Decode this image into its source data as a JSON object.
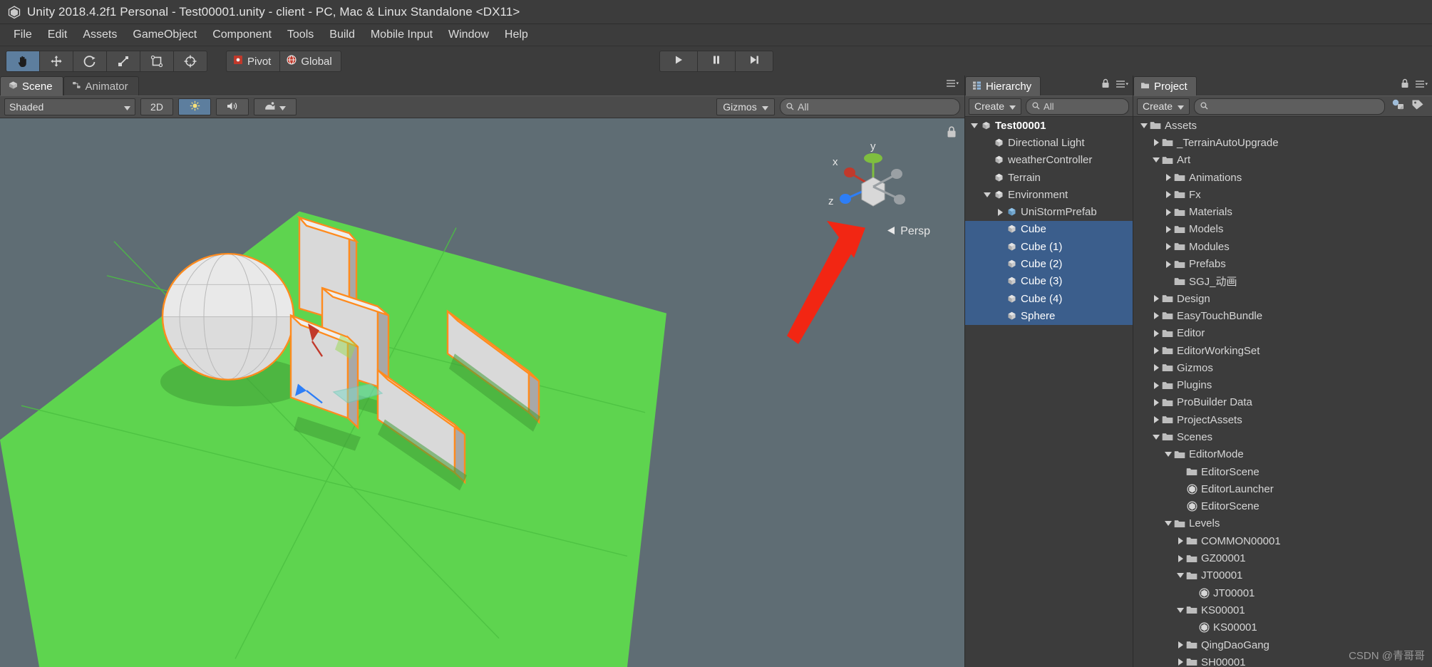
{
  "window": {
    "title": "Unity 2018.4.2f1 Personal - Test00001.unity - client - PC, Mac & Linux Standalone <DX11>",
    "logo_icon": "unity-logo-icon"
  },
  "menubar": {
    "items": [
      {
        "label": "File"
      },
      {
        "label": "Edit"
      },
      {
        "label": "Assets"
      },
      {
        "label": "GameObject"
      },
      {
        "label": "Component"
      },
      {
        "label": "Tools"
      },
      {
        "label": "Build"
      },
      {
        "label": "Mobile Input"
      },
      {
        "label": "Window"
      },
      {
        "label": "Help"
      }
    ]
  },
  "toolbar": {
    "tools": [
      {
        "name": "hand-tool",
        "icon": "hand-icon",
        "active": true
      },
      {
        "name": "move-tool",
        "icon": "move-icon",
        "active": false
      },
      {
        "name": "rotate-tool",
        "icon": "rotate-icon",
        "active": false
      },
      {
        "name": "scale-tool",
        "icon": "scale-icon",
        "active": false
      },
      {
        "name": "rect-tool",
        "icon": "rect-icon",
        "active": false
      },
      {
        "name": "transform-tool",
        "icon": "transform-icon",
        "active": false
      }
    ],
    "pivot_label": "Pivot",
    "pivot_icon": "pivot-icon",
    "global_label": "Global",
    "global_icon": "global-icon",
    "play_icon": "play-icon",
    "pause_icon": "pause-icon",
    "step_icon": "step-icon"
  },
  "scene": {
    "tabs": [
      {
        "label": "Scene",
        "icon": "scene-icon",
        "active": true
      },
      {
        "label": "Animator",
        "icon": "animator-icon",
        "active": false
      }
    ],
    "draw_mode": "Shaded",
    "view_mode_2d": "2D",
    "lighting_icon": "lighting-icon",
    "audio_icon": "audio-icon",
    "effects_icon": "effects-icon",
    "gizmos_label": "Gizmos",
    "search_placeholder": "All",
    "search_value": "",
    "search_icon": "search-icon",
    "lock_icon": "lock-icon",
    "gizmo_axis_x": "x",
    "gizmo_axis_y": "y",
    "gizmo_axis_z": "z",
    "persp_label": "Persp",
    "persp_arrow_icon": "chevron-left-icon",
    "colors": {
      "ground": "#5ed44f",
      "sky": "#5f6d74",
      "selection_outline": "#ff8b1e",
      "annotation_arrow": "#f22613"
    }
  },
  "hierarchy": {
    "tab_label": "Hierarchy",
    "tab_icon": "hierarchy-icon",
    "lock_icon": "lock-icon",
    "menu_icon": "burger-menu-icon",
    "create_label": "Create",
    "create_dropdown_icon": "chevron-down-icon",
    "search_placeholder": "All",
    "search_icon": "search-icon",
    "items": [
      {
        "label": "Test00001",
        "depth": 0,
        "expanded": true,
        "icon": "scene-icon",
        "selected": false,
        "is_scene": true
      },
      {
        "label": "Directional Light",
        "depth": 1,
        "expanded": null,
        "icon": "gameobject-icon",
        "selected": false
      },
      {
        "label": "weatherController",
        "depth": 1,
        "expanded": null,
        "icon": "gameobject-icon",
        "selected": false
      },
      {
        "label": "Terrain",
        "depth": 1,
        "expanded": null,
        "icon": "gameobject-icon",
        "selected": false
      },
      {
        "label": "Environment",
        "depth": 1,
        "expanded": true,
        "icon": "gameobject-icon",
        "selected": false
      },
      {
        "label": "UniStormPrefab",
        "depth": 2,
        "expanded": false,
        "icon": "prefab-icon",
        "selected": false
      },
      {
        "label": "Cube",
        "depth": 2,
        "expanded": null,
        "icon": "gameobject-icon",
        "selected": true
      },
      {
        "label": "Cube (1)",
        "depth": 2,
        "expanded": null,
        "icon": "gameobject-icon",
        "selected": true
      },
      {
        "label": "Cube (2)",
        "depth": 2,
        "expanded": null,
        "icon": "gameobject-icon",
        "selected": true
      },
      {
        "label": "Cube (3)",
        "depth": 2,
        "expanded": null,
        "icon": "gameobject-icon",
        "selected": true
      },
      {
        "label": "Cube (4)",
        "depth": 2,
        "expanded": null,
        "icon": "gameobject-icon",
        "selected": true
      },
      {
        "label": "Sphere",
        "depth": 2,
        "expanded": null,
        "icon": "gameobject-icon",
        "selected": true
      }
    ]
  },
  "project": {
    "tab_label": "Project",
    "tab_icon": "project-icon",
    "lock_icon": "lock-icon",
    "menu_icon": "burger-menu-icon",
    "create_label": "Create",
    "create_dropdown_icon": "chevron-down-icon",
    "search_placeholder": "",
    "search_icon": "search-icon",
    "filter_type_icon": "filter-type-icon",
    "filter_label_icon": "filter-label-icon",
    "items": [
      {
        "label": "Assets",
        "depth": 0,
        "expanded": true,
        "icon": "folder-icon"
      },
      {
        "label": "_TerrainAutoUpgrade",
        "depth": 1,
        "expanded": false,
        "icon": "folder-icon"
      },
      {
        "label": "Art",
        "depth": 1,
        "expanded": true,
        "icon": "folder-icon"
      },
      {
        "label": "Animations",
        "depth": 2,
        "expanded": false,
        "icon": "folder-icon"
      },
      {
        "label": "Fx",
        "depth": 2,
        "expanded": false,
        "icon": "folder-icon"
      },
      {
        "label": "Materials",
        "depth": 2,
        "expanded": false,
        "icon": "folder-icon"
      },
      {
        "label": "Models",
        "depth": 2,
        "expanded": false,
        "icon": "folder-icon"
      },
      {
        "label": "Modules",
        "depth": 2,
        "expanded": false,
        "icon": "folder-icon"
      },
      {
        "label": "Prefabs",
        "depth": 2,
        "expanded": false,
        "icon": "folder-icon"
      },
      {
        "label": "SGJ_动画",
        "depth": 2,
        "expanded": null,
        "icon": "folder-icon"
      },
      {
        "label": "Design",
        "depth": 1,
        "expanded": false,
        "icon": "folder-icon"
      },
      {
        "label": "EasyTouchBundle",
        "depth": 1,
        "expanded": false,
        "icon": "folder-icon"
      },
      {
        "label": "Editor",
        "depth": 1,
        "expanded": false,
        "icon": "folder-icon"
      },
      {
        "label": "EditorWorkingSet",
        "depth": 1,
        "expanded": false,
        "icon": "folder-icon"
      },
      {
        "label": "Gizmos",
        "depth": 1,
        "expanded": false,
        "icon": "folder-icon"
      },
      {
        "label": "Plugins",
        "depth": 1,
        "expanded": false,
        "icon": "folder-icon"
      },
      {
        "label": "ProBuilder Data",
        "depth": 1,
        "expanded": false,
        "icon": "folder-icon"
      },
      {
        "label": "ProjectAssets",
        "depth": 1,
        "expanded": false,
        "icon": "folder-icon"
      },
      {
        "label": "Scenes",
        "depth": 1,
        "expanded": true,
        "icon": "folder-icon"
      },
      {
        "label": "EditorMode",
        "depth": 2,
        "expanded": true,
        "icon": "folder-icon"
      },
      {
        "label": "EditorScene",
        "depth": 3,
        "expanded": null,
        "icon": "folder-icon"
      },
      {
        "label": "EditorLauncher",
        "depth": 3,
        "expanded": null,
        "icon": "scene-asset-icon"
      },
      {
        "label": "EditorScene",
        "depth": 3,
        "expanded": null,
        "icon": "scene-asset-icon"
      },
      {
        "label": "Levels",
        "depth": 2,
        "expanded": true,
        "icon": "folder-icon"
      },
      {
        "label": "COMMON00001",
        "depth": 3,
        "expanded": false,
        "icon": "folder-icon"
      },
      {
        "label": "GZ00001",
        "depth": 3,
        "expanded": false,
        "icon": "folder-icon"
      },
      {
        "label": "JT00001",
        "depth": 3,
        "expanded": true,
        "icon": "folder-icon"
      },
      {
        "label": "JT00001",
        "depth": 4,
        "expanded": null,
        "icon": "scene-asset-icon"
      },
      {
        "label": "KS00001",
        "depth": 3,
        "expanded": true,
        "icon": "folder-icon"
      },
      {
        "label": "KS00001",
        "depth": 4,
        "expanded": null,
        "icon": "scene-asset-icon"
      },
      {
        "label": "QingDaoGang",
        "depth": 3,
        "expanded": false,
        "icon": "folder-icon"
      },
      {
        "label": "SH00001",
        "depth": 3,
        "expanded": false,
        "icon": "folder-icon"
      }
    ]
  },
  "watermark": {
    "text": "CSDN @青哥哥"
  }
}
